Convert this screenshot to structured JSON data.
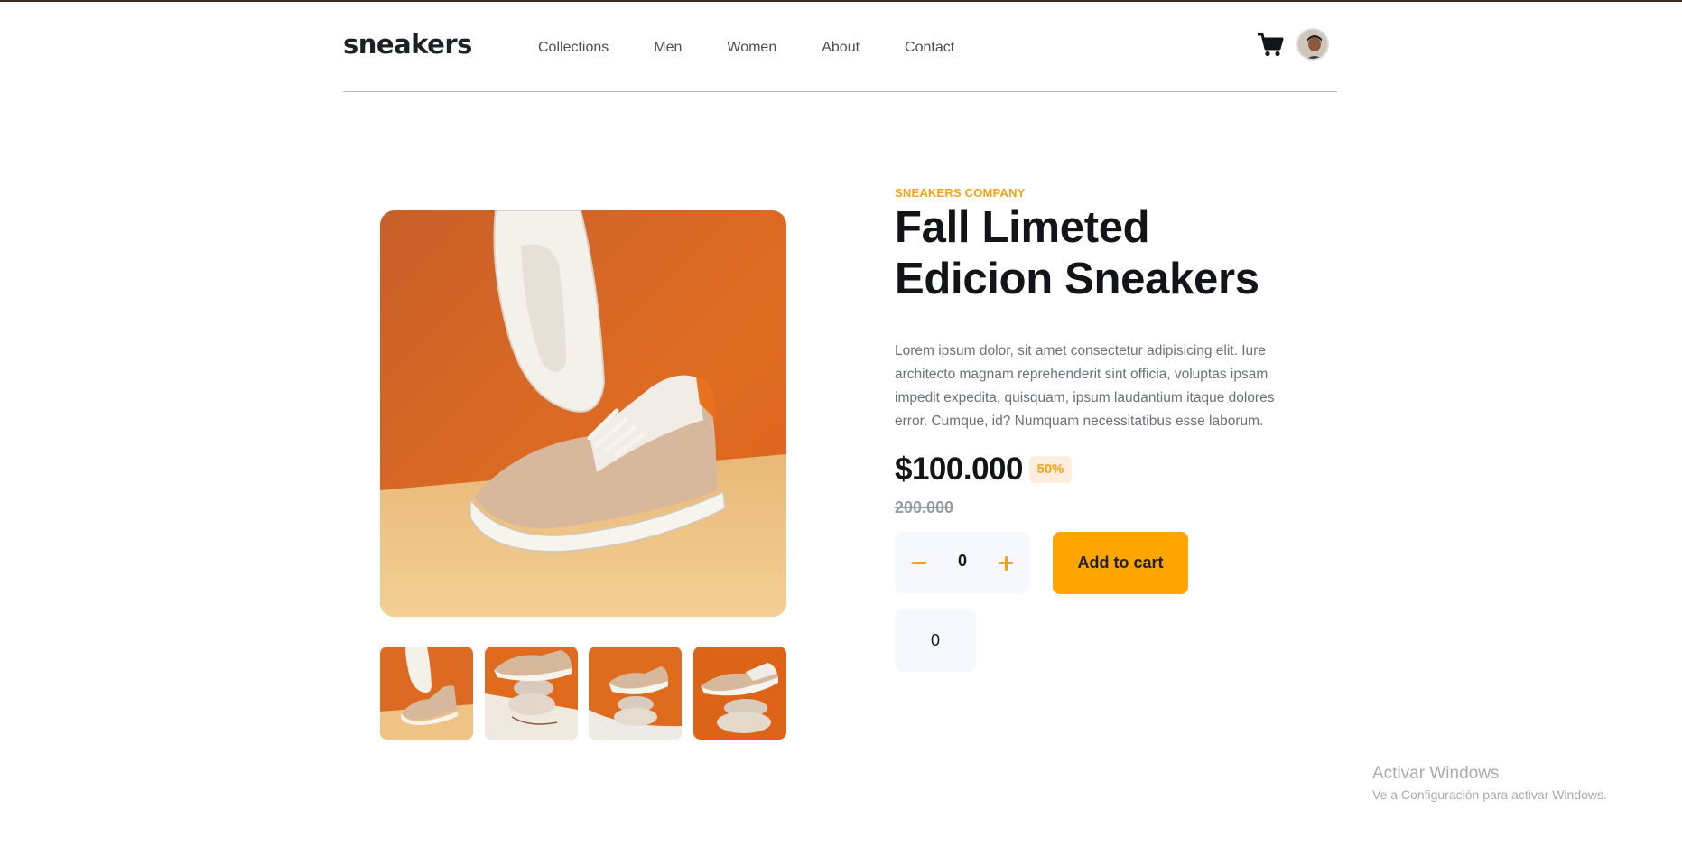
{
  "header": {
    "logo": "sneakers",
    "nav": [
      "Collections",
      "Men",
      "Women",
      "About",
      "Contact"
    ]
  },
  "product": {
    "company": "SNEAKERS COMPANY",
    "title_line1": "Fall Limeted",
    "title_line2": "Edicion Sneakers",
    "description": "Lorem ipsum dolor, sit amet consectetur adipisicing elit. Iure architecto magnam reprehenderit sint officia, voluptas ipsam impedit expedita, quisquam, ipsum laudantium itaque dolores error. Cumque, id? Numquam necessitatibus esse laborum.",
    "price": "$100.000",
    "discount": "50%",
    "old_price": "200.000"
  },
  "quantity": {
    "value": "0",
    "add_label": "Add to cart",
    "counter": "0"
  },
  "watermark": {
    "title": "Activar Windows",
    "subtitle": "Ve a Configuración para activar Windows."
  },
  "colors": {
    "accent": "#ffa500",
    "accent_text": "#f5a21b",
    "badge_bg": "#ffeede",
    "dark": "#131418"
  }
}
